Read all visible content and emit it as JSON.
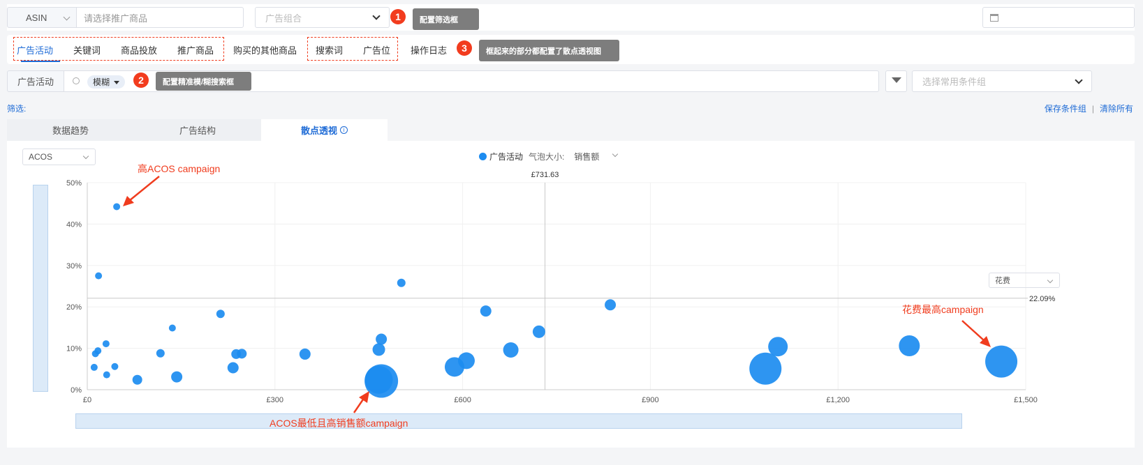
{
  "top": {
    "asin_label": "ASIN",
    "product_placeholder": "请选择推广商品",
    "group_placeholder": "广告组合"
  },
  "tips": {
    "tip1": "配置筛选框",
    "tip2": "配置精准模/糊搜索框",
    "tip3": "框起来的部分都配置了散点透视图",
    "badge1": "1",
    "badge2": "2",
    "badge3": "3"
  },
  "tabs": [
    "广告活动",
    "关键词",
    "商品投放",
    "推广商品",
    "购买的其他商品",
    "搜索词",
    "广告位",
    "操作日志"
  ],
  "search_row": {
    "label": "广告活动",
    "mode": "模糊",
    "condition_placeholder": "选择常用条件组"
  },
  "filter_label": "筛选:",
  "save_group": "保存条件组",
  "clear_all": "清除所有",
  "view_tabs": [
    "数据趋势",
    "广告结构",
    "散点透视"
  ],
  "chart_controls": {
    "metric": "ACOS",
    "legend_series": "广告活动",
    "bubble_label": "气泡大小:",
    "bubble_metric": "销售额",
    "x_metric": "花费"
  },
  "annotations": {
    "high_acos": "高ACOS campaign",
    "low_acos": "ACOS最低且高销售额campaign",
    "high_spend": "花费最高campaign"
  },
  "colors": {
    "accent": "#1e6bd6",
    "bubble": "#1c8cf0",
    "annotation": "#f03c1e"
  },
  "chart_data": {
    "type": "scatter",
    "x_ticks": [
      "£0",
      "£300",
      "£600",
      "£900",
      "£1,200",
      "£1,500"
    ],
    "y_ticks": [
      "0%",
      "10%",
      "20%",
      "30%",
      "40%",
      "50%"
    ],
    "xlim": [
      0,
      1500
    ],
    "ylim": [
      0,
      50
    ],
    "ref_x_label": "£731.63",
    "ref_x": 731.63,
    "ref_y_label": "22.09%",
    "ref_y": 22.09,
    "series": [
      {
        "name": "广告活动",
        "points": [
          {
            "x": 47,
            "y": 44.2,
            "r": 5
          },
          {
            "x": 18,
            "y": 27.5,
            "r": 5
          },
          {
            "x": 11,
            "y": 5.4,
            "r": 5
          },
          {
            "x": 13,
            "y": 8.7,
            "r": 5
          },
          {
            "x": 17,
            "y": 9.4,
            "r": 5
          },
          {
            "x": 30,
            "y": 11.1,
            "r": 5
          },
          {
            "x": 31,
            "y": 3.6,
            "r": 5
          },
          {
            "x": 44,
            "y": 5.6,
            "r": 5
          },
          {
            "x": 80,
            "y": 2.4,
            "r": 7
          },
          {
            "x": 117,
            "y": 8.8,
            "r": 6
          },
          {
            "x": 136,
            "y": 14.9,
            "r": 5
          },
          {
            "x": 143,
            "y": 3.1,
            "r": 8
          },
          {
            "x": 213,
            "y": 18.3,
            "r": 6
          },
          {
            "x": 233,
            "y": 5.3,
            "r": 8
          },
          {
            "x": 238,
            "y": 8.6,
            "r": 7
          },
          {
            "x": 247,
            "y": 8.7,
            "r": 7
          },
          {
            "x": 348,
            "y": 8.6,
            "r": 8
          },
          {
            "x": 466,
            "y": 9.7,
            "r": 9
          },
          {
            "x": 470,
            "y": 12.2,
            "r": 8
          },
          {
            "x": 466,
            "y": 2.4,
            "r": 20
          },
          {
            "x": 470,
            "y": 2.1,
            "r": 24
          },
          {
            "x": 502,
            "y": 25.8,
            "r": 6
          },
          {
            "x": 587,
            "y": 5.5,
            "r": 14
          },
          {
            "x": 606,
            "y": 7.0,
            "r": 12
          },
          {
            "x": 637,
            "y": 19.0,
            "r": 8
          },
          {
            "x": 677,
            "y": 9.6,
            "r": 11
          },
          {
            "x": 722,
            "y": 14.0,
            "r": 9
          },
          {
            "x": 836,
            "y": 20.5,
            "r": 8
          },
          {
            "x": 1084,
            "y": 5.1,
            "r": 23
          },
          {
            "x": 1104,
            "y": 10.4,
            "r": 14
          },
          {
            "x": 1314,
            "y": 10.6,
            "r": 15
          },
          {
            "x": 1461,
            "y": 6.8,
            "r": 23
          }
        ]
      }
    ],
    "grid": true,
    "legend_position": "top-center"
  }
}
